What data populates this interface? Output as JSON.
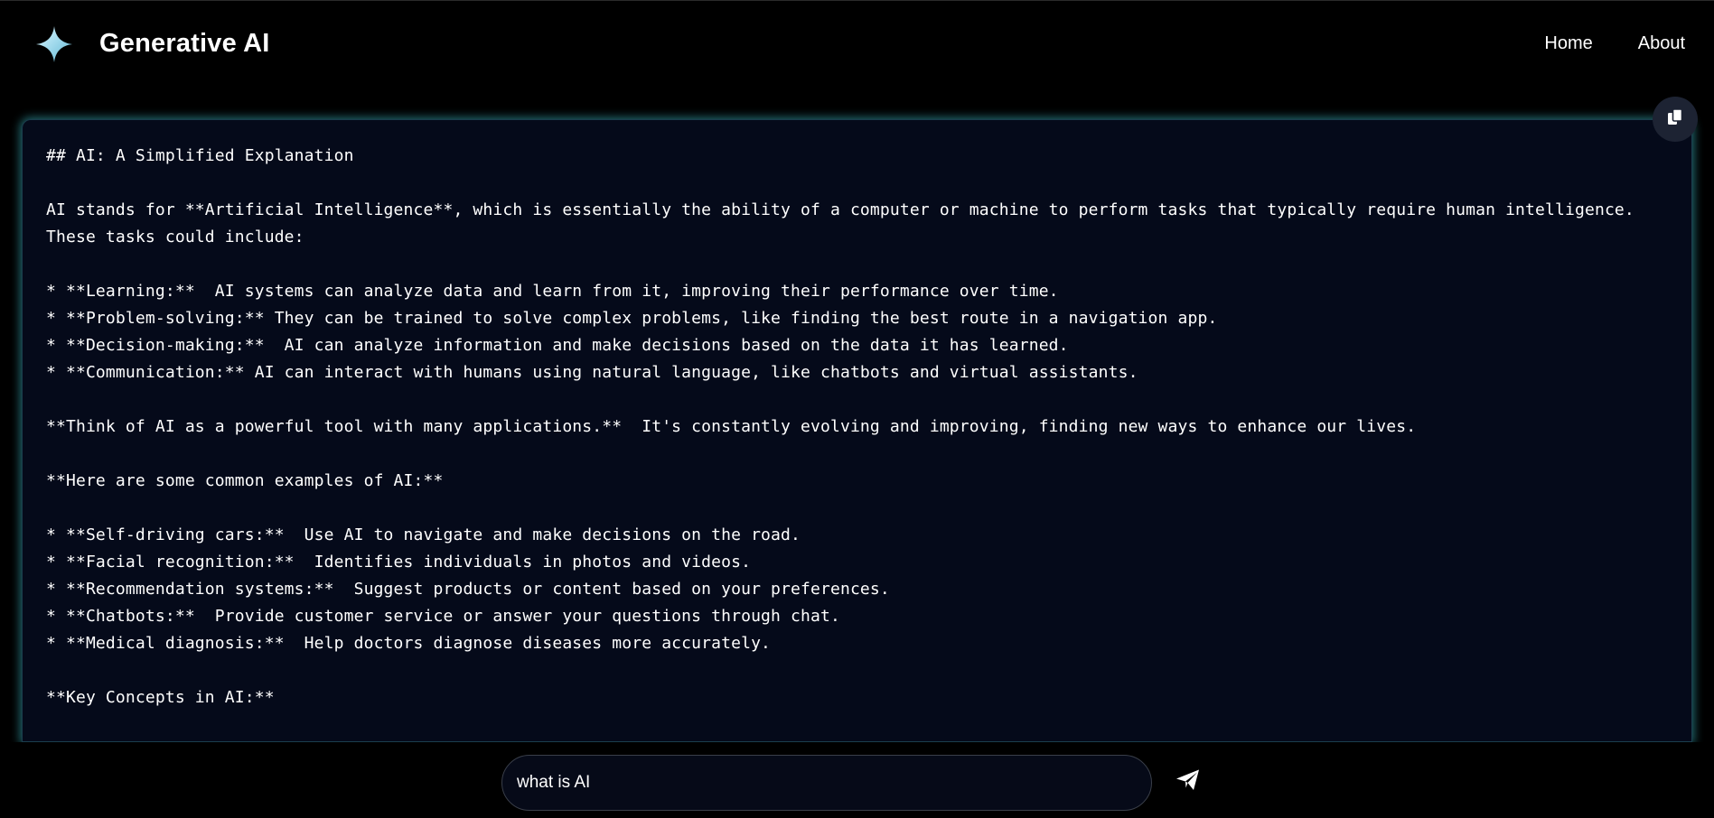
{
  "header": {
    "brand_title": "Generative AI",
    "logo_icon": "sparkle-icon",
    "nav": [
      {
        "label": "Home"
      },
      {
        "label": "About"
      }
    ]
  },
  "response": {
    "text": "## AI: A Simplified Explanation\n\nAI stands for **Artificial Intelligence**, which is essentially the ability of a computer or machine to perform tasks that typically require human intelligence. These tasks could include:\n\n* **Learning:**  AI systems can analyze data and learn from it, improving their performance over time.\n* **Problem-solving:** They can be trained to solve complex problems, like finding the best route in a navigation app.\n* **Decision-making:**  AI can analyze information and make decisions based on the data it has learned.\n* **Communication:** AI can interact with humans using natural language, like chatbots and virtual assistants.\n\n**Think of AI as a powerful tool with many applications.**  It's constantly evolving and improving, finding new ways to enhance our lives.\n\n**Here are some common examples of AI:**\n\n* **Self-driving cars:**  Use AI to navigate and make decisions on the road.\n* **Facial recognition:**  Identifies individuals in photos and videos.\n* **Recommendation systems:**  Suggest products or content based on your preferences.\n* **Chatbots:**  Provide customer service or answer your questions through chat.\n* **Medical diagnosis:**  Help doctors diagnose diseases more accurately.\n\n**Key Concepts in AI:**",
    "copy_icon": "copy-icon"
  },
  "prompt": {
    "value": "what is AI",
    "send_icon": "send-icon"
  },
  "colors": {
    "background": "#000000",
    "panel": "#050a1a",
    "panel_glow": "#3cbec8",
    "logo": "#8fd4e8"
  }
}
